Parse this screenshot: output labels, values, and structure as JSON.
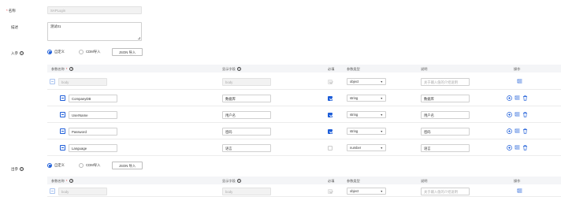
{
  "form": {
    "name_label": "名称",
    "name_value": "SAPLogin",
    "desc_label": "描述",
    "desc_value": "测试01",
    "input_label": "入参",
    "output_label": "出参",
    "required_mark": "*",
    "help_glyph": "?"
  },
  "input_mode": {
    "custom_label": "自定义",
    "cdm_label": "CDM导入",
    "json_button": "JSON 导入",
    "selected": "自定义"
  },
  "output_mode": {
    "custom_label": "自定义",
    "cdm_label": "CDM导入",
    "json_button": "JSON 导入",
    "selected": "自定义"
  },
  "table_headers": {
    "param_name": "参数名称",
    "display_field": "显示字段",
    "required": "必填",
    "param_type": "参数类型",
    "description": "说明",
    "actions": "操作"
  },
  "input_rows": [
    {
      "name": "body",
      "display": "body",
      "required": true,
      "type": "object",
      "description": "",
      "description_placeholder": "关于输入值的介绍说明",
      "disabled": true
    },
    {
      "name": "CompanyDB",
      "display": "数据库",
      "required": true,
      "type": "string",
      "description": "数据库",
      "description_placeholder": "",
      "disabled": false
    },
    {
      "name": "UserName",
      "display": "用户名",
      "required": true,
      "type": "string",
      "description": "用户名",
      "description_placeholder": "",
      "disabled": false
    },
    {
      "name": "Password",
      "display": "密码",
      "required": true,
      "type": "string",
      "description": "密码",
      "description_placeholder": "",
      "disabled": false
    },
    {
      "name": "Language",
      "display": "语言",
      "required": false,
      "type": "number",
      "description": "语言",
      "description_placeholder": "",
      "disabled": false
    }
  ],
  "output_rows": [
    {
      "name": "body",
      "display": "body",
      "required": true,
      "type": "object",
      "description": "",
      "description_placeholder": "关于输入值的介绍说明",
      "disabled": true
    }
  ],
  "icons": {
    "add": "add-circle-icon",
    "subtree": "subtree-icon",
    "delete": "trash-icon",
    "collapse": "collapse-minus-icon",
    "caret": "▼"
  },
  "colors": {
    "accent": "#1d5dd8",
    "required": "#e4393c",
    "header_bg": "#f4f5f7"
  }
}
